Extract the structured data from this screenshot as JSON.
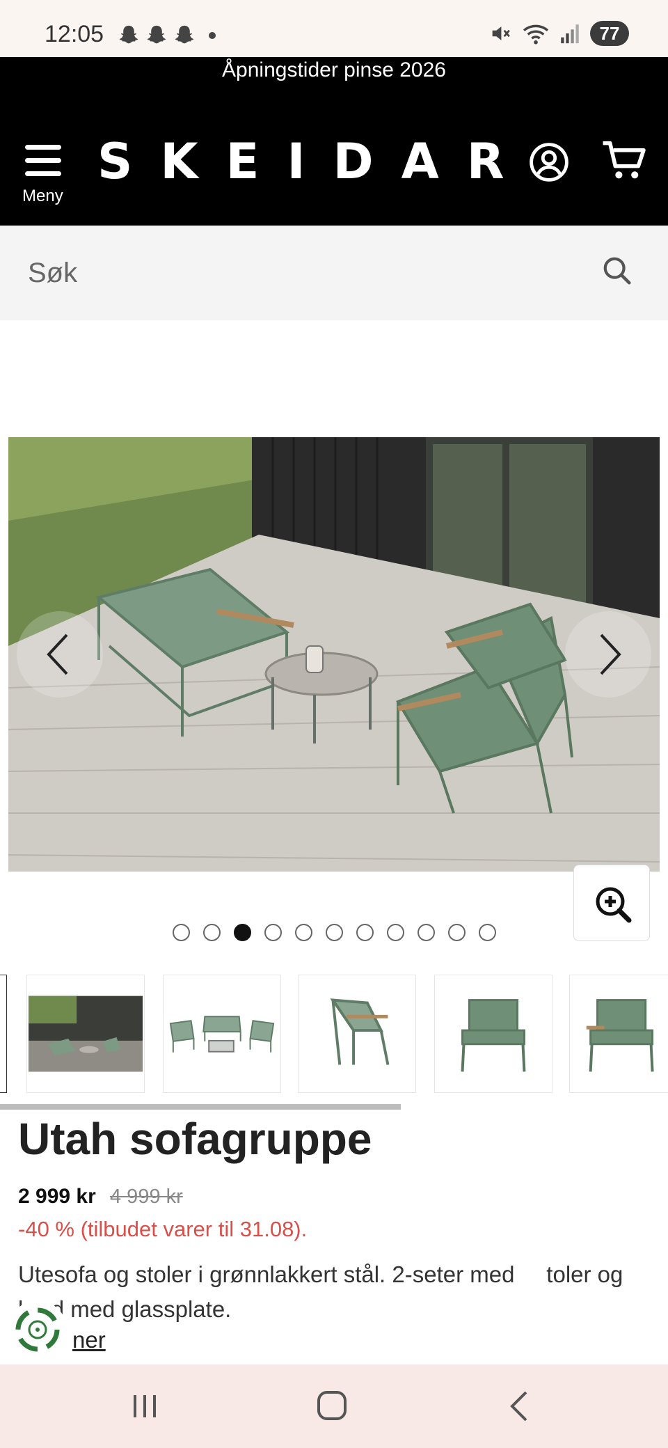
{
  "status_bar": {
    "time": "12:05",
    "battery": "77",
    "icons": [
      "snapchat-icon",
      "snapchat-icon",
      "snapchat-icon",
      "dot-icon",
      "mute-icon",
      "wifi-icon",
      "signal-icon",
      "battery-icon"
    ]
  },
  "header": {
    "promo": "Åpningstider pinse 2026",
    "menu_label": "Meny",
    "logo": "SKEIDAR",
    "colors": {
      "background": "#000000",
      "text": "#ffffff"
    }
  },
  "search": {
    "placeholder": "Søk"
  },
  "gallery": {
    "dot_count": 11,
    "active_dot": 3,
    "thumbnails": [
      "thumb-lifestyle-patio",
      "thumb-set-overview",
      "thumb-chair-side",
      "thumb-chair-front",
      "thumb-chair-angle"
    ]
  },
  "product": {
    "title": "Utah sofagruppe",
    "price": "2 999 kr",
    "old_price": "4 999 kr",
    "discount": "-40 % (tilbudet varer til 31.08).",
    "description": "Utesofa og stoler i grønnlakkert stål. 2-seter med     toler og bord med glassplate.",
    "more_link": "ner",
    "colors": {
      "discount": "#d9504a"
    }
  },
  "nav": {
    "buttons": [
      "recent-apps",
      "home",
      "back"
    ]
  }
}
